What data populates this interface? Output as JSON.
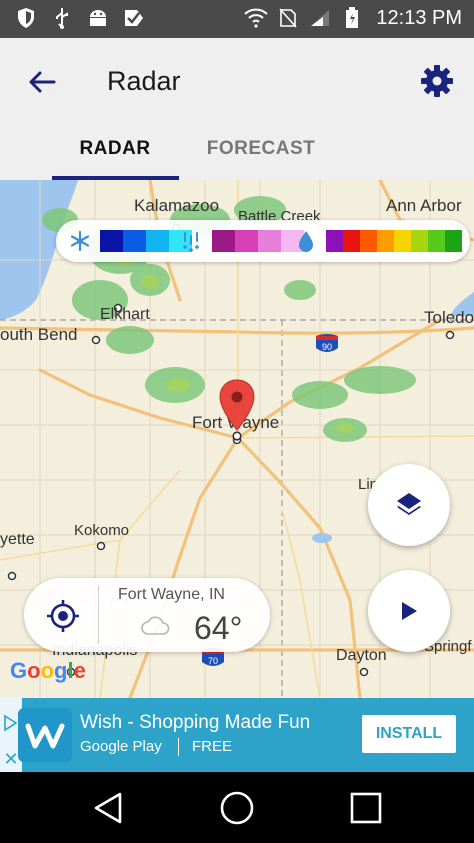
{
  "status_bar": {
    "time": "12:13 PM",
    "icons_left": [
      "shield-icon",
      "usb-icon",
      "android-icon",
      "check-icon"
    ],
    "icons_right": [
      "wifi-icon",
      "no-sim-icon",
      "signal-icon",
      "battery-icon"
    ]
  },
  "app_bar": {
    "title": "Radar",
    "back_icon": "arrow-back-icon",
    "settings_icon": "gear-icon"
  },
  "tabs": [
    {
      "label": "RADAR",
      "selected": true
    },
    {
      "label": "FORECAST",
      "selected": false
    }
  ],
  "colors": {
    "accent": "#1a237e",
    "ad_background": "#2ea3c9",
    "snow": [
      "#0a14a6",
      "#0a5ce6",
      "#11b3f0",
      "#2fe6f7"
    ],
    "mix": [
      "#9c1a86",
      "#d640b6",
      "#e67fd9",
      "#f3b8f0"
    ],
    "rain": [
      "#8c12b8",
      "#e8150f",
      "#ff5a00",
      "#ff9d00",
      "#f5d400",
      "#a6d60c",
      "#56c91a",
      "#1ca317"
    ]
  },
  "legend": {
    "snow_icon": "snowflake-icon",
    "mix_icon": "mixed-precip-icon",
    "rain_icon": "raindrop-icon"
  },
  "map": {
    "labels": [
      {
        "text": "Kalamazoo"
      },
      {
        "text": "Battle Creek"
      },
      {
        "text": "Ann Arbor"
      },
      {
        "text": "Elkhart"
      },
      {
        "text": "outh Bend"
      },
      {
        "text": "Toledo"
      },
      {
        "text": "Fort Wayne"
      },
      {
        "text": "Kokomo"
      },
      {
        "text": "yette"
      },
      {
        "text": "Lim"
      },
      {
        "text": "Springf"
      },
      {
        "text": "Indianapolis"
      },
      {
        "text": "Dayton"
      }
    ],
    "highway_90": "90",
    "highway_70": "70",
    "attribution": "Google"
  },
  "location_card": {
    "name": "Fort Wayne, IN",
    "temperature": "64°",
    "condition_icon": "cloud-icon",
    "locate_icon": "my-location-icon"
  },
  "fabs": {
    "layers_icon": "layers-icon",
    "play_icon": "play-icon"
  },
  "ad": {
    "title": "Wish - Shopping Made Fun",
    "store": "Google Play",
    "price": "FREE",
    "cta": "INSTALL",
    "close": "✕"
  },
  "nav_bar": {
    "icons": [
      "back-triangle-icon",
      "home-circle-icon",
      "recents-square-icon"
    ]
  }
}
